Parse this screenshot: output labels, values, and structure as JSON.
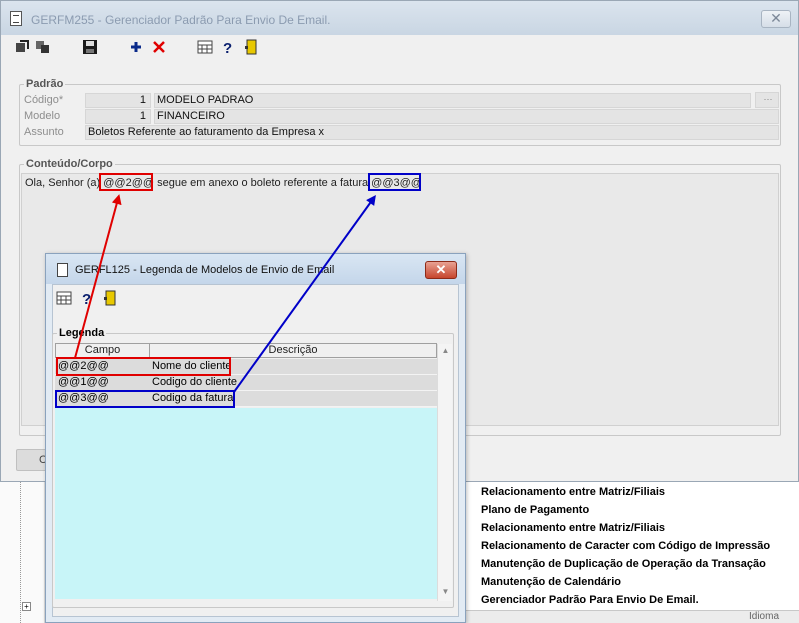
{
  "main_window": {
    "title": "GERFM255 - Gerenciador Padrão Para Envio De Email.",
    "close_glyph": "✕"
  },
  "padrao": {
    "legend": "Padrão",
    "codigo_label": "Código*",
    "codigo_num": "1",
    "codigo_desc": "MODELO PADRAO",
    "modelo_label": "Modelo",
    "modelo_num": "1",
    "modelo_desc": "FINANCEIRO",
    "assunto_label": "Assunto",
    "assunto_value": "Boletos Referente ao faturamento da  Empresa x"
  },
  "conteudo": {
    "legend": "Conteúdo/Corpo",
    "text_prefix": "Ola, Senhor (a) ",
    "tag_cliente": "@@2@@",
    "text_middle": " segue em anexo o boleto referente a fatura ",
    "tag_fatura": "@@3@@"
  },
  "main_bottom_button": "C",
  "menu_items": [
    "Relacionamento entre Matriz/Filiais",
    "Plano de Pagamento",
    "Relacionamento entre Matriz/Filiais",
    "Relacionamento de Caracter com Código de Impressão",
    "Manutenção de Duplicação de Operação da Transação",
    "Manutenção de Calendário",
    "Gerenciador Padrão Para Envio De Email."
  ],
  "status_strip_label": "Idioma",
  "dialog": {
    "title": "GERFL125 - Legenda de Modelos de Envio de Email",
    "close_glyph": "✕",
    "legend": "Legenda",
    "columns": [
      "Campo",
      "Descrição"
    ],
    "rows": [
      {
        "campo": "@@2@@",
        "descricao": "Nome do cliente"
      },
      {
        "campo": "@@1@@",
        "descricao": "Codigo do cliente"
      },
      {
        "campo": "@@3@@",
        "descricao": "Codigo da fatura"
      }
    ]
  },
  "colors": {
    "annotation_red": "#e00000",
    "annotation_blue": "#0000c8",
    "grid_empty": "#c8f5f8"
  },
  "icons": [
    "move-icon",
    "copy-icon",
    "save-icon",
    "add-icon",
    "delete-icon",
    "calculator-icon",
    "help-icon",
    "exit-door-icon",
    "lookup-icon",
    "tree-expand-icon"
  ]
}
